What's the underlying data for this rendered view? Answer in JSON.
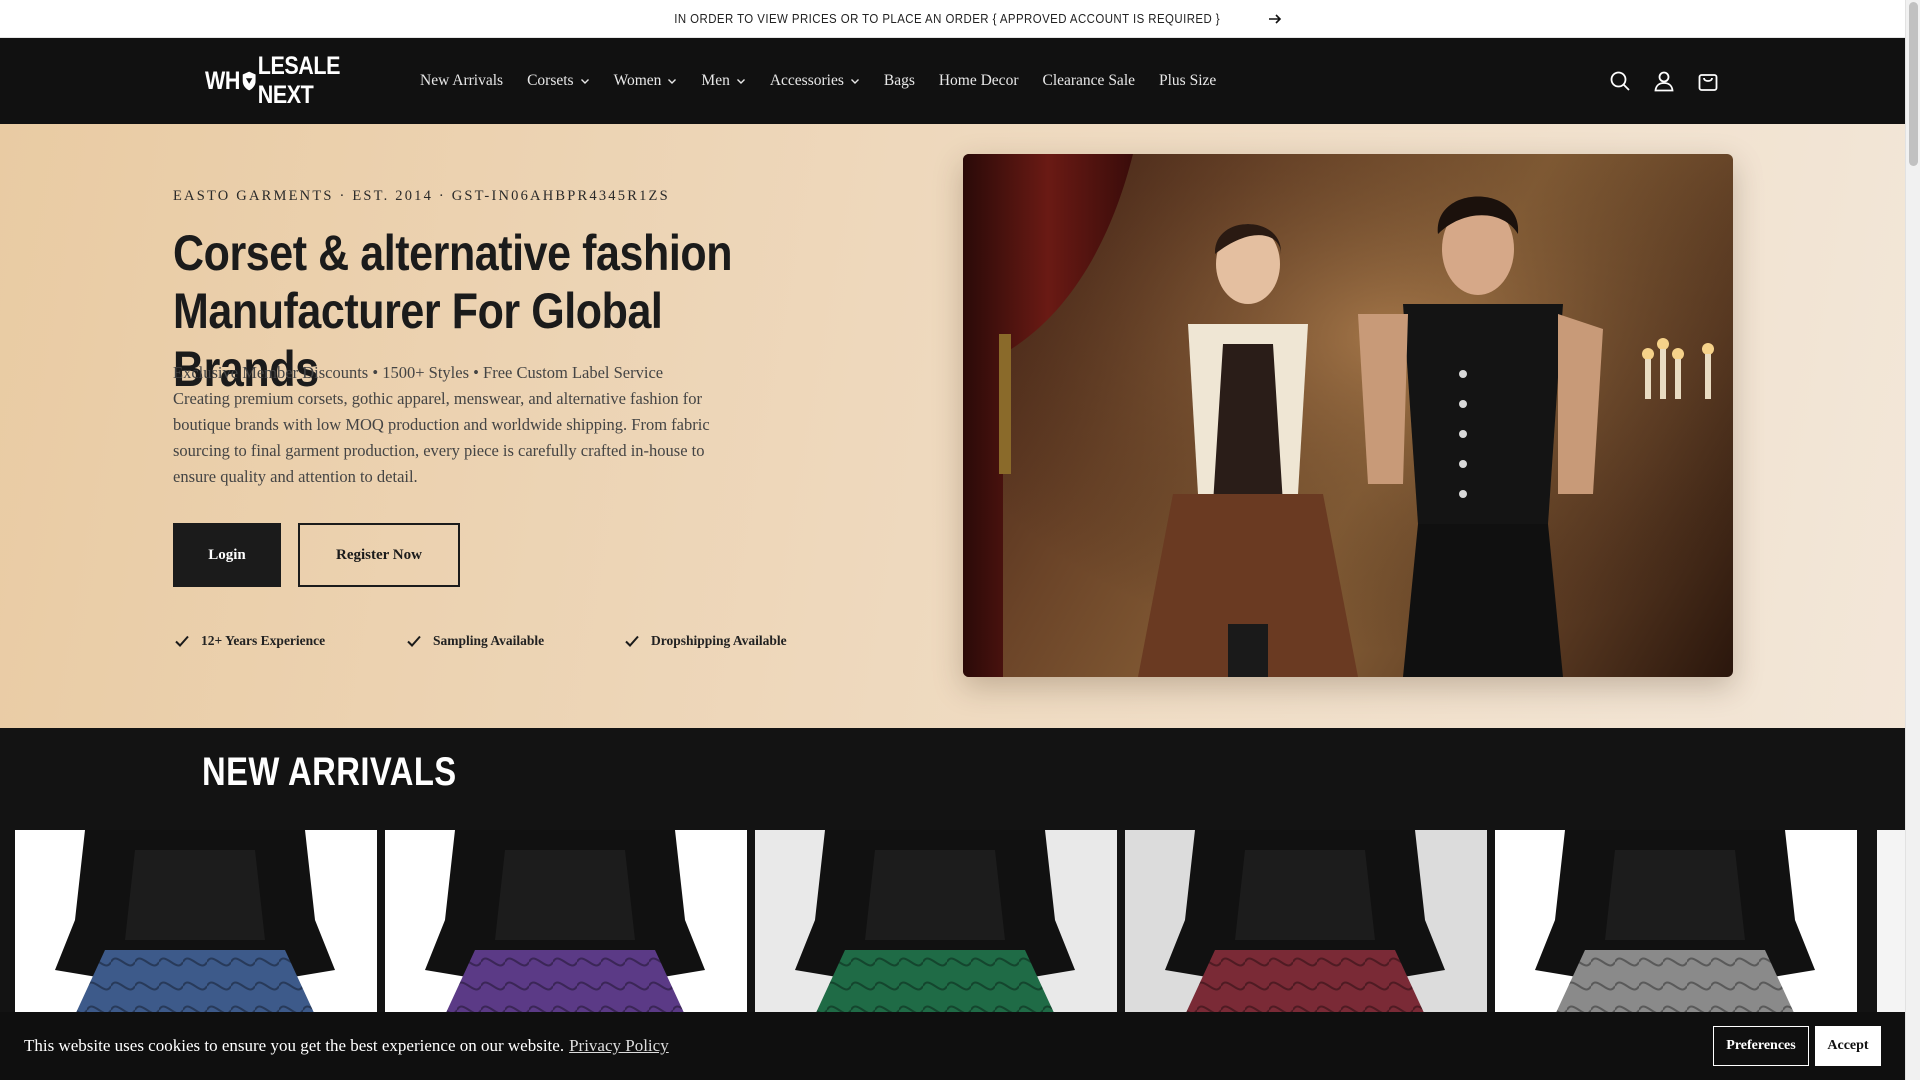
{
  "announcement": {
    "text": "IN ORDER TO VIEW PRICES OR TO PLACE AN ORDER { APPROVED ACCOUNT IS REQUIRED }"
  },
  "header": {
    "logo_left": "WH",
    "logo_right": "LESALE NEXT",
    "nav": [
      {
        "label": "New Arrivals",
        "dropdown": false
      },
      {
        "label": "Corsets",
        "dropdown": true
      },
      {
        "label": "Women",
        "dropdown": true
      },
      {
        "label": "Men",
        "dropdown": true
      },
      {
        "label": "Accessories",
        "dropdown": true
      },
      {
        "label": "Bags",
        "dropdown": false
      },
      {
        "label": "Home Decor",
        "dropdown": false
      },
      {
        "label": "Clearance Sale",
        "dropdown": false
      },
      {
        "label": "Plus Size",
        "dropdown": false
      }
    ],
    "icons": [
      "search-icon",
      "account-icon",
      "cart-icon"
    ]
  },
  "hero": {
    "eyebrow": "EASTO GARMENTS · EST. 2014 · GST-IN06AHBPR4345R1ZS",
    "headline_line1": "Corset & alternative fashion",
    "headline_line2": "Manufacturer For Global Brands",
    "desc_line1": "Exclusive Member Discounts • 1500+ Styles • Free Custom Label Service",
    "desc_rest": "Creating premium corsets, gothic apparel, menswear, and alternative fashion for boutique brands with low MOQ production and worldwide shipping. From fabric sourcing to final garment production, every piece is carefully crafted in-house to ensure quality and attention to detail.",
    "login_label": "Login",
    "register_label": "Register Now",
    "features": [
      "12+ Years Experience",
      "Sampling Available",
      "Dropshipping Available"
    ]
  },
  "arrivals": {
    "title": "NEW ARRIVALS",
    "products": [
      {
        "skirt_color": "#3d5a8a",
        "bg": "#ffffff"
      },
      {
        "skirt_color": "#5b3a86",
        "bg": "#ffffff"
      },
      {
        "skirt_color": "#1f6b46",
        "bg": "#e9e9e9"
      },
      {
        "skirt_color": "#7a2a36",
        "bg": "#dcdcdc"
      },
      {
        "skirt_color": "#8a8a8a",
        "bg": "#ffffff"
      }
    ]
  },
  "cookie": {
    "message": "This website uses cookies to ensure you get the best experience on our website.",
    "link": "Privacy Policy",
    "preferences_label": "Preferences",
    "accept_label": "Accept"
  },
  "colors": {
    "header_bg": "#111111",
    "hero_gradient_start": "#e9cba3",
    "hero_gradient_end": "#f3e7d9",
    "button_dark": "#1b1b1b"
  }
}
